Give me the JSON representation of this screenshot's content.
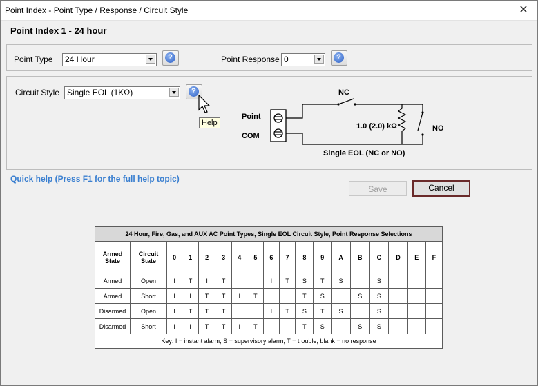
{
  "window": {
    "title": "Point Index - Point Type / Response / Circuit Style",
    "close": "✕"
  },
  "page_title": "Point Index 1 - 24 hour",
  "point_type": {
    "label": "Point Type",
    "value": "24 Hour"
  },
  "point_response": {
    "label": "Point Response",
    "value": "0"
  },
  "circuit_style": {
    "label": "Circuit Style",
    "value": "Single EOL (1KΩ)"
  },
  "help": {
    "glyph": "?",
    "tooltip": "Help"
  },
  "diagram": {
    "point": "Point",
    "com": "COM",
    "nc": "NC",
    "no": "NO",
    "resistor": "1.0 (2.0) kΩ",
    "caption": "Single EOL (NC or NO)"
  },
  "quick_help": "Quick help (Press F1 for the full help topic)",
  "buttons": {
    "save": "Save",
    "cancel": "Cancel"
  },
  "table": {
    "caption": "24 Hour, Fire, Gas, and AUX AC Point Types, Single EOL Circuit Style, Point Response Selections",
    "headers": [
      "Armed State",
      "Circuit State",
      "0",
      "1",
      "2",
      "3",
      "4",
      "5",
      "6",
      "7",
      "8",
      "9",
      "A",
      "B",
      "C",
      "D",
      "E",
      "F"
    ],
    "rows": [
      [
        "Armed",
        "Open",
        "I",
        "T",
        "I",
        "T",
        "",
        "",
        "I",
        "T",
        "S",
        "T",
        "S",
        "",
        "S",
        "",
        "",
        ""
      ],
      [
        "Armed",
        "Short",
        "I",
        "I",
        "T",
        "T",
        "I",
        "T",
        "",
        "",
        "T",
        "S",
        "",
        "S",
        "S",
        "",
        "",
        ""
      ],
      [
        "Disarmed",
        "Open",
        "I",
        "T",
        "T",
        "T",
        "",
        "",
        "I",
        "T",
        "S",
        "T",
        "S",
        "",
        "S",
        "",
        "",
        ""
      ],
      [
        "Disarmed",
        "Short",
        "I",
        "I",
        "T",
        "T",
        "I",
        "T",
        "",
        "",
        "T",
        "S",
        "",
        "S",
        "S",
        "",
        "",
        ""
      ]
    ],
    "key": "Key: I = instant alarm, S = supervisory alarm, T = trouble, blank = no response"
  },
  "colors": {
    "quick_help": "#3a7fd0",
    "default_button_border": "#6a2a2a",
    "table_caption_bg": "#d8d8d8"
  },
  "icons": [
    "close-icon",
    "help-icon",
    "dropdown-arrow-icon",
    "mouse-cursor-icon",
    "terminal-screw-icon"
  ]
}
